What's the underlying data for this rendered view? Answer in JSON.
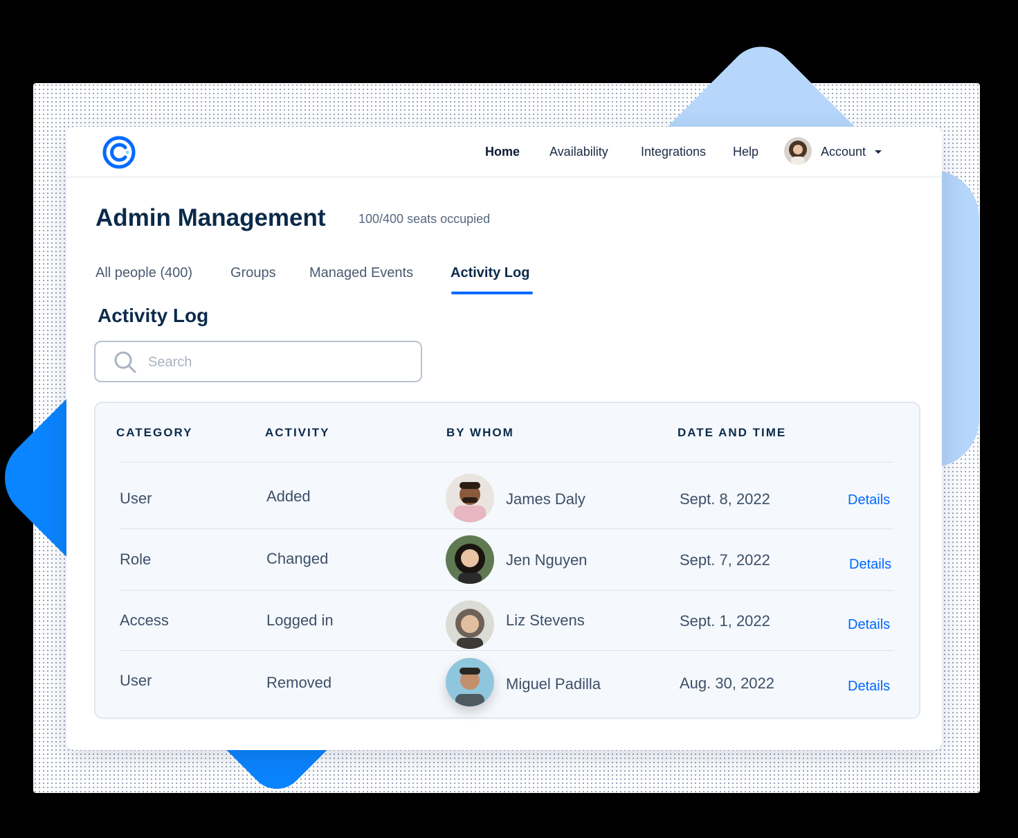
{
  "nav": {
    "items": [
      "Home",
      "Availability",
      "Integrations",
      "Help"
    ],
    "active": "Home",
    "account_label": "Account"
  },
  "header": {
    "title": "Admin Management",
    "seats": "100/400 seats occupied"
  },
  "tabs": [
    {
      "label": "All people (400)"
    },
    {
      "label": "Groups"
    },
    {
      "label": "Managed Events"
    },
    {
      "label": "Activity Log",
      "active": true
    }
  ],
  "section": {
    "title": "Activity Log",
    "search_placeholder": "Search"
  },
  "table": {
    "headers": [
      "CATEGORY",
      "ACTIVITY",
      "BY WHOM",
      "DATE AND TIME"
    ],
    "rows": [
      {
        "category": "User",
        "activity": "Added",
        "person": "James Daly",
        "date": "Sept. 8, 2022",
        "action": "Details"
      },
      {
        "category": "Role",
        "activity": "Changed",
        "person": "Jen Nguyen",
        "date": "Sept. 7, 2022",
        "action": "Details"
      },
      {
        "category": "Access",
        "activity": "Logged in",
        "person": "Liz Stevens",
        "date": "Sept. 1, 2022",
        "action": "Details"
      },
      {
        "category": "User",
        "activity": "Removed",
        "person": "Miguel Padilla",
        "date": "Aug. 30, 2022",
        "action": "Details"
      }
    ]
  },
  "colors": {
    "brand": "#0069ff",
    "navy": "#0b2a4a",
    "deco_light": "#b6d7fb",
    "deco_dark": "#0a84ff"
  }
}
